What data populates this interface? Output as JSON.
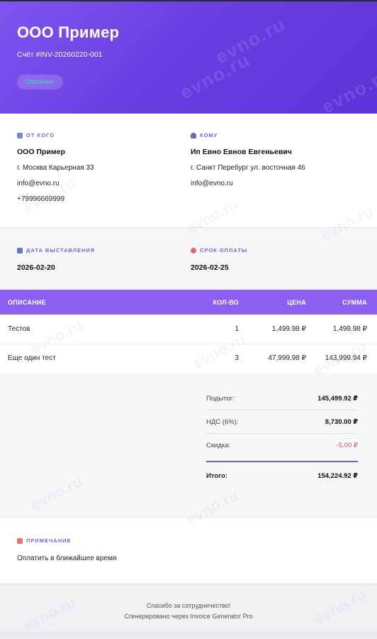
{
  "header": {
    "company": "ООО Пример",
    "invoice_number": "Счёт #INV-20260220-001",
    "status": "Оплачен"
  },
  "from": {
    "label": "От кого",
    "name": "ООО Пример",
    "address": "г. Москва Карьерная 33",
    "email": "info@evno.ru",
    "phone": "+79996669999"
  },
  "to": {
    "label": "Кому",
    "name": "Ип Евно Евнов Евгеньевич",
    "address": "г. Санкт Перебург ул. восточная 46",
    "email": "info@evno.ru"
  },
  "dates": {
    "issue_label": "Дата выставления",
    "issue_value": "2026-02-20",
    "due_label": "Срок оплаты",
    "due_value": "2026-02-25"
  },
  "items_table": {
    "headers": [
      "Описание",
      "Кол-во",
      "Цена",
      "Сумма"
    ],
    "rows": [
      {
        "description": "Тестов",
        "qty": "1",
        "price": "1,499.98 ₽",
        "sum": "1,499.98 ₽"
      },
      {
        "description": "Еще один тест",
        "qty": "3",
        "price": "47,999.98 ₽",
        "sum": "143,999.94 ₽"
      }
    ]
  },
  "totals": {
    "subtotal_label": "Подытог:",
    "subtotal_value": "145,499.92 ₽",
    "vat_label": "НДС (6%):",
    "vat_value": "8,730.00 ₽",
    "discount_label": "Скидка:",
    "discount_value": "-5.00 ₽",
    "total_label": "Итого:",
    "total_value": "154,224.92 ₽"
  },
  "notes": {
    "label": "Примечание",
    "text": "Оплатить в ближайшее время"
  },
  "footer": {
    "line1": "Спасибо за сотрудничество!",
    "line2": "Сгенерировано через Invoice Generator Pro"
  },
  "watermark": "evno.ru",
  "colors": {
    "accent": "#7c5bde",
    "header_gradient_start": "#7e55f0",
    "header_gradient_end": "#5d33d8",
    "status_text": "#3ee0a4",
    "discount": "#e05555"
  },
  "icons": {
    "from": "building-icon",
    "to": "person-icon",
    "issue_date": "calendar-icon",
    "due_date": "alarm-clock-icon",
    "notes": "memo-icon"
  }
}
